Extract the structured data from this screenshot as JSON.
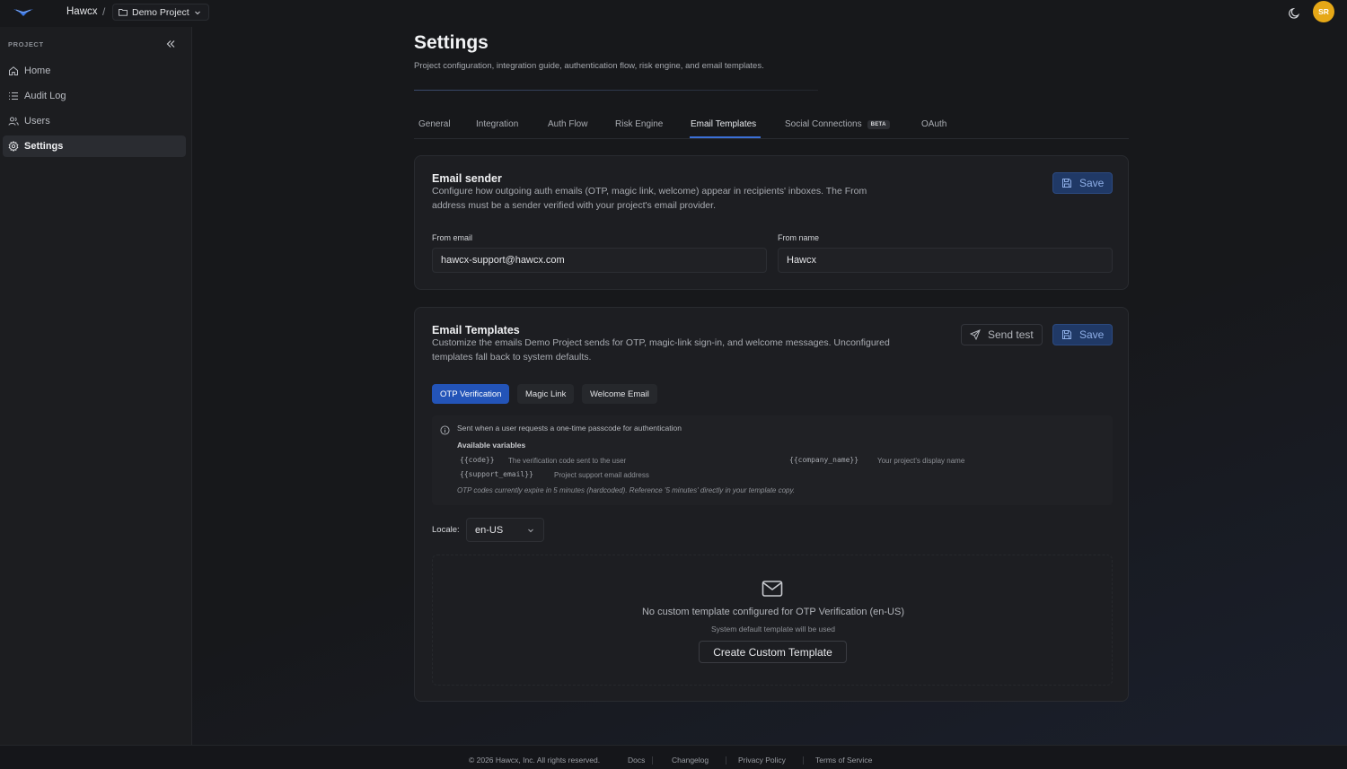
{
  "topbar": {
    "org_name": "Hawcx",
    "separator": "/",
    "project_name": "Demo Project",
    "avatar_initials": "SR",
    "avatar_color": "#e6a817"
  },
  "sidebar": {
    "heading": "PROJECT",
    "items": [
      {
        "label": "Home",
        "icon": "home-icon"
      },
      {
        "label": "Audit Log",
        "icon": "list-icon"
      },
      {
        "label": "Users",
        "icon": "users-icon"
      },
      {
        "label": "Settings",
        "icon": "gear-icon",
        "active": true
      }
    ]
  },
  "page": {
    "title": "Settings",
    "subtitle": "Project configuration, integration guide, authentication flow, risk engine, and email templates."
  },
  "tabs": [
    {
      "label": "General"
    },
    {
      "label": "Integration"
    },
    {
      "label": "Auth Flow"
    },
    {
      "label": "Risk Engine"
    },
    {
      "label": "Email Templates",
      "active": true
    },
    {
      "label": "Social Connections",
      "badge": "BETA"
    },
    {
      "label": "OAuth"
    }
  ],
  "email_sender": {
    "title": "Email sender",
    "description": "Configure how outgoing auth emails (OTP, magic link, welcome) appear in recipients' inboxes. The From address must be a sender verified with your project's email provider.",
    "save_label": "Save",
    "from_email_label": "From email",
    "from_email_value": "hawcx-support@hawcx.com",
    "from_name_label": "From name",
    "from_name_value": "Hawcx"
  },
  "email_templates": {
    "title": "Email Templates",
    "description": "Customize the emails Demo Project sends for OTP, magic-link sign-in, and welcome messages. Unconfigured templates fall back to system defaults.",
    "send_test_label": "Send test",
    "save_label": "Save",
    "template_tabs": [
      {
        "label": "OTP Verification",
        "active": true
      },
      {
        "label": "Magic Link"
      },
      {
        "label": "Welcome Email"
      }
    ],
    "info_text": "Sent when a user requests a one-time passcode for authentication",
    "available_variables_heading": "Available variables",
    "variables": [
      {
        "code": "{{code}}",
        "desc": "The verification code sent to the user"
      },
      {
        "code": "{{company_name}}",
        "desc": "Your project's display name"
      },
      {
        "code": "{{support_email}}",
        "desc": "Project support email address"
      }
    ],
    "note": "OTP codes currently expire in 5 minutes (hardcoded). Reference '5 minutes' directly in your template copy.",
    "locale_label": "Locale:",
    "locale_value": "en-US",
    "empty_title": "No custom template configured for OTP Verification (en-US)",
    "empty_subtitle": "System default template will be used",
    "create_label": "Create Custom Template"
  },
  "footer": {
    "copyright": "© 2026 Hawcx, Inc. All rights reserved.",
    "links": [
      "Docs",
      "Changelog",
      "Privacy Policy",
      "Terms of Service"
    ]
  },
  "colors": {
    "accent": "#2354b8",
    "background": "#17181b",
    "card": "#1d1e22"
  }
}
